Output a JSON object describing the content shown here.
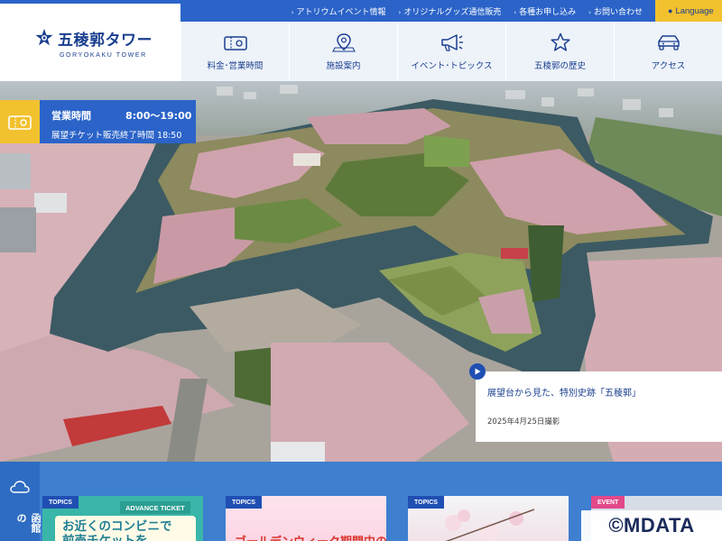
{
  "brand": {
    "name": "五稜郭タワー",
    "sub": "GORYOKAKU TOWER"
  },
  "topbar": {
    "links": [
      "アトリウムイベント情報",
      "オリジナルグッズ通信販売",
      "各種お申し込み",
      "お問い合わせ"
    ],
    "language": "Language"
  },
  "nav": {
    "items": [
      {
        "label": "料金･営業時間",
        "icon": "ticket-icon"
      },
      {
        "label": "施設案内",
        "icon": "map-pin-icon"
      },
      {
        "label": "イベント･トピックス",
        "icon": "megaphone-icon"
      },
      {
        "label": "五稜郭の歴史",
        "icon": "star-icon"
      },
      {
        "label": "アクセス",
        "icon": "car-icon"
      }
    ]
  },
  "hours": {
    "label": "営業時間",
    "time": "8:00〜19:00",
    "ticket_note": "展望チケット販売終了時間 18:50"
  },
  "hero_caption": {
    "title": "展望台から見た、特別史跡「五稜郭」",
    "date": "2025年4月25日撮影"
  },
  "news": {
    "side_label": "函館の",
    "cards": [
      {
        "tag": "TOPICS",
        "ribbon": "ADVANCE TICKET",
        "line1": "お近くのコンビニで",
        "line2": "前売チケットを"
      },
      {
        "tag": "TOPICS",
        "headline": "ゴールデンウィーク期間中の"
      },
      {
        "tag": "TOPICS"
      },
      {
        "tag": "EVENT"
      }
    ]
  },
  "watermark": "©MDATA",
  "colors": {
    "brand_blue": "#2b63c8",
    "navy_text": "#1a3f8f",
    "accent_yellow": "#f2c12e",
    "nav_bg": "#eef3fa",
    "topics_tag": "#1f4fb3",
    "event_tag": "#e2498a"
  }
}
